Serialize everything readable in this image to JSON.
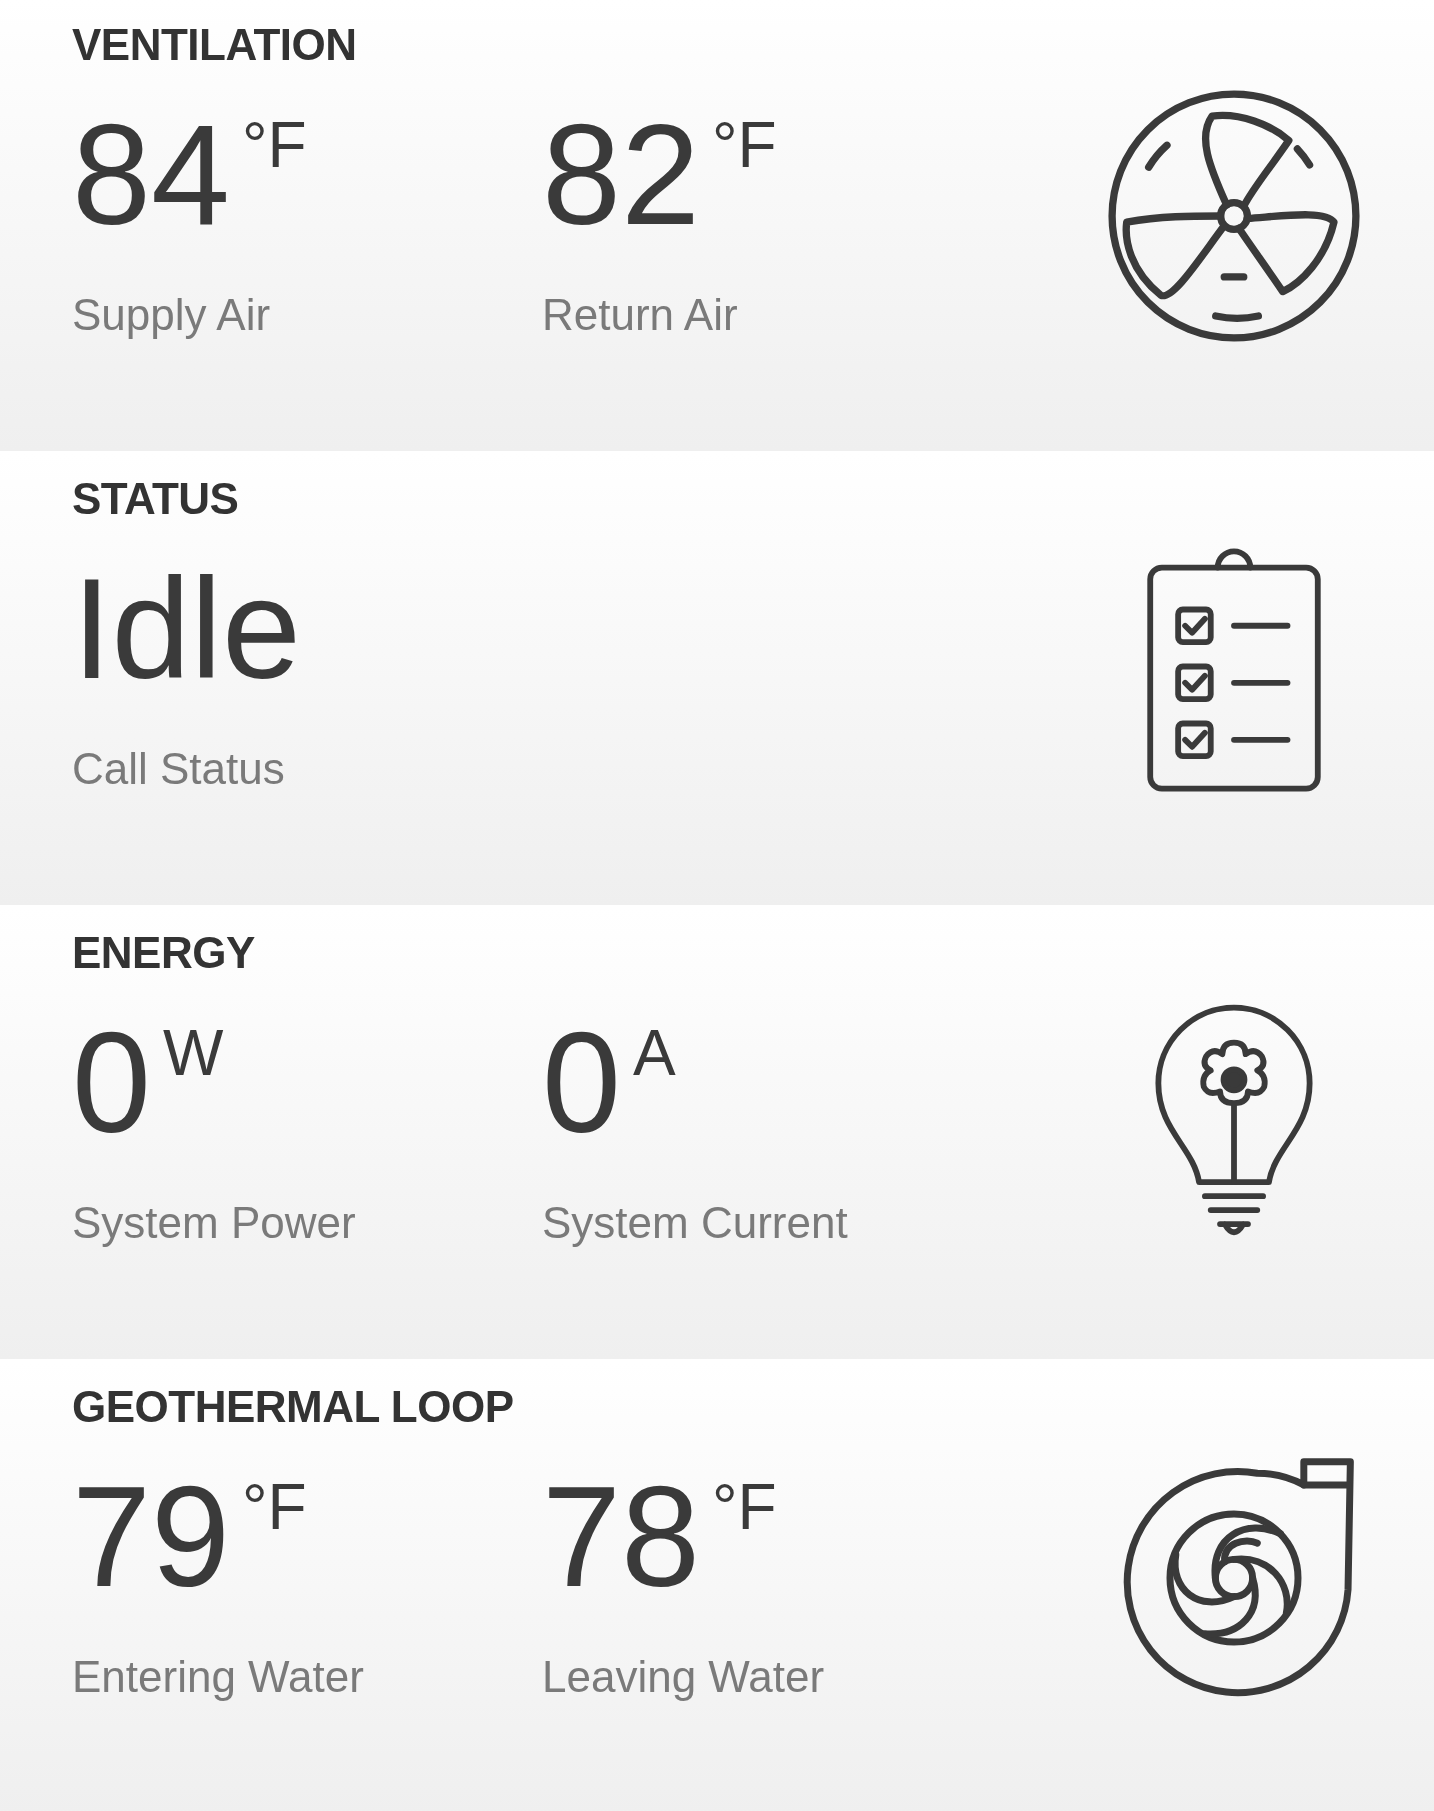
{
  "sections": [
    {
      "title": "VENTILATION",
      "readings": [
        {
          "value": "84",
          "unit": "°F",
          "label": "Supply Air"
        },
        {
          "value": "82",
          "unit": "°F",
          "label": "Return Air"
        }
      ]
    },
    {
      "title": "STATUS",
      "readings": [
        {
          "value": "Idle",
          "label": "Call Status"
        }
      ]
    },
    {
      "title": "ENERGY",
      "readings": [
        {
          "value": "0",
          "unit": "W",
          "label": "System Power"
        },
        {
          "value": "0",
          "unit": "A",
          "label": "System Current"
        }
      ]
    },
    {
      "title": "GEOTHERMAL LOOP",
      "readings": [
        {
          "value": "79",
          "unit": "°F",
          "label": "Entering Water"
        },
        {
          "value": "78",
          "unit": "°F",
          "label": "Leaving Water"
        }
      ]
    }
  ]
}
